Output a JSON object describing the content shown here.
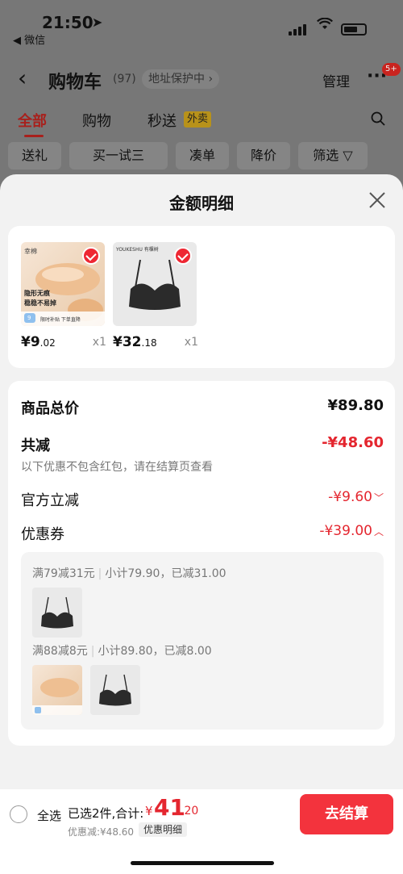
{
  "status": {
    "time": "21:50",
    "back_app": "◀ 微信"
  },
  "navbar": {
    "title": "购物车",
    "count": "(97)",
    "protect": "地址保护中 ›",
    "manage": "管理",
    "more_badge": "5+"
  },
  "tabs": [
    {
      "label": "全部"
    },
    {
      "label": "购物"
    },
    {
      "label": "秒送"
    }
  ],
  "tab_badge": "外卖",
  "filters": [
    {
      "label": "送礼"
    },
    {
      "label": "买一试三"
    },
    {
      "label": "凑单"
    },
    {
      "label": "降价"
    },
    {
      "label": "筛选 ▽"
    }
  ],
  "sheet": {
    "title": "金额明细"
  },
  "products": [
    {
      "price_int": "¥9",
      "price_dec": ".02",
      "qty": "x1",
      "img_text_1": "幸棉",
      "img_text_2": "隐形无痕",
      "img_text_3": "稳稳不易掉",
      "img_text_4": "限时补贴 下单直降",
      "img_tag": "9"
    },
    {
      "price_int": "¥32",
      "price_dec": ".18",
      "qty": "x1",
      "img_brand": "YOUKESHU 有棵树"
    }
  ],
  "summary": {
    "total_label": "商品总价",
    "total_value": "¥89.80",
    "reduce_label": "共减",
    "reduce_value": "-¥48.60",
    "note": "以下优惠不包含红包，请在结算页查看",
    "official_label": "官方立减",
    "official_value": "-¥9.60",
    "coupon_label": "优惠券",
    "coupon_value": "-¥39.00"
  },
  "coupons": [
    {
      "rule": "满79减31元",
      "detail": "小计79.90，已减31.00"
    },
    {
      "rule": "满88减8元",
      "detail": "小计89.80，已减8.00"
    }
  ],
  "bottom": {
    "select_all": "全选",
    "selected": "已选2件,合计:",
    "currency": "¥",
    "total_int": "41",
    "total_dec": ".20",
    "discount": "优惠减:¥48.60",
    "detail_chip": "优惠明细",
    "checkout": "去结算"
  },
  "colors": {
    "accent": "#e4262f",
    "checkout_bg": "#f3333d"
  }
}
